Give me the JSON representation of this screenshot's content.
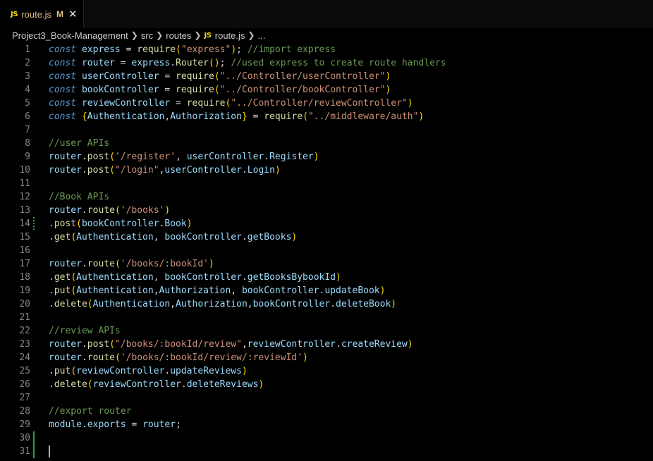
{
  "tab": {
    "icon": "JS",
    "name": "route.js",
    "modified_badge": "M",
    "close": "✕"
  },
  "breadcrumb": {
    "items": [
      "Project3_Book-Management",
      "src",
      "routes",
      "route.js",
      "..."
    ],
    "file_icon": "JS"
  },
  "colors": {
    "keyword": "#569cd6",
    "variable": "#9cdcfe",
    "function": "#dcdcaa",
    "string": "#ce9178",
    "comment": "#6a9955",
    "bracket_level1": "#ffd700",
    "bracket_level2": "#da70d6",
    "git_added": "#2ea043",
    "modified_tab": "#e2c08d"
  },
  "code_lines": [
    [
      {
        "t": "const",
        "c": "kw"
      },
      {
        "t": " "
      },
      {
        "t": "express",
        "c": "vr"
      },
      {
        "t": " = "
      },
      {
        "t": "require",
        "c": "fn"
      },
      {
        "t": "(",
        "c": "br1"
      },
      {
        "t": "\"express\"",
        "c": "st"
      },
      {
        "t": ")",
        "c": "br1"
      },
      {
        "t": "; "
      },
      {
        "t": "//import express",
        "c": "cm"
      }
    ],
    [
      {
        "t": "const",
        "c": "kw"
      },
      {
        "t": " "
      },
      {
        "t": "router",
        "c": "vr"
      },
      {
        "t": " = "
      },
      {
        "t": "express",
        "c": "vr"
      },
      {
        "t": "."
      },
      {
        "t": "Router",
        "c": "fn"
      },
      {
        "t": "()",
        "c": "br1"
      },
      {
        "t": "; "
      },
      {
        "t": "//used express to create route handlers",
        "c": "cm"
      }
    ],
    [
      {
        "t": "const",
        "c": "kw"
      },
      {
        "t": " "
      },
      {
        "t": "userController",
        "c": "vr"
      },
      {
        "t": " = "
      },
      {
        "t": "require",
        "c": "fn"
      },
      {
        "t": "(",
        "c": "br1"
      },
      {
        "t": "\"../Controller/userController\"",
        "c": "st"
      },
      {
        "t": ")",
        "c": "br1"
      }
    ],
    [
      {
        "t": "const",
        "c": "kw"
      },
      {
        "t": " "
      },
      {
        "t": "bookController",
        "c": "vr"
      },
      {
        "t": " = "
      },
      {
        "t": "require",
        "c": "fn"
      },
      {
        "t": "(",
        "c": "br1"
      },
      {
        "t": "\"../Controller/bookController\"",
        "c": "st"
      },
      {
        "t": ")",
        "c": "br1"
      }
    ],
    [
      {
        "t": "const",
        "c": "kw"
      },
      {
        "t": " "
      },
      {
        "t": "reviewController",
        "c": "vr"
      },
      {
        "t": " = "
      },
      {
        "t": "require",
        "c": "fn"
      },
      {
        "t": "(",
        "c": "br1"
      },
      {
        "t": "\"../Controller/reviewController\"",
        "c": "st"
      },
      {
        "t": ")",
        "c": "br1"
      }
    ],
    [
      {
        "t": "const",
        "c": "kw"
      },
      {
        "t": " "
      },
      {
        "t": "{",
        "c": "br1"
      },
      {
        "t": "Authentication",
        "c": "vr"
      },
      {
        "t": ","
      },
      {
        "t": "Authorization",
        "c": "vr"
      },
      {
        "t": "}",
        "c": "br1"
      },
      {
        "t": " = "
      },
      {
        "t": "require",
        "c": "fn"
      },
      {
        "t": "(",
        "c": "br1"
      },
      {
        "t": "\"../middleware/auth\"",
        "c": "st"
      },
      {
        "t": ")",
        "c": "br1"
      }
    ],
    [],
    [
      {
        "t": "//user APIs",
        "c": "cm"
      }
    ],
    [
      {
        "t": "router",
        "c": "vr"
      },
      {
        "t": "."
      },
      {
        "t": "post",
        "c": "fn"
      },
      {
        "t": "(",
        "c": "br1"
      },
      {
        "t": "'/register'",
        "c": "st"
      },
      {
        "t": ", "
      },
      {
        "t": "userController",
        "c": "vr"
      },
      {
        "t": "."
      },
      {
        "t": "Register",
        "c": "vr"
      },
      {
        "t": ")",
        "c": "br1"
      }
    ],
    [
      {
        "t": "router",
        "c": "vr"
      },
      {
        "t": "."
      },
      {
        "t": "post",
        "c": "fn"
      },
      {
        "t": "(",
        "c": "br1"
      },
      {
        "t": "\"/login\"",
        "c": "st"
      },
      {
        "t": ","
      },
      {
        "t": "userController",
        "c": "vr"
      },
      {
        "t": "."
      },
      {
        "t": "Login",
        "c": "vr"
      },
      {
        "t": ")",
        "c": "br1"
      }
    ],
    [],
    [
      {
        "t": "//Book APIs",
        "c": "cm"
      }
    ],
    [
      {
        "t": "router",
        "c": "vr"
      },
      {
        "t": "."
      },
      {
        "t": "route",
        "c": "fn"
      },
      {
        "t": "(",
        "c": "br1"
      },
      {
        "t": "'/books'",
        "c": "st"
      },
      {
        "t": ")",
        "c": "br1"
      }
    ],
    [
      {
        "t": "."
      },
      {
        "t": "post",
        "c": "fn"
      },
      {
        "t": "(",
        "c": "br1"
      },
      {
        "t": "bookController",
        "c": "vr"
      },
      {
        "t": "."
      },
      {
        "t": "Book",
        "c": "vr"
      },
      {
        "t": ")",
        "c": "br1"
      }
    ],
    [
      {
        "t": "."
      },
      {
        "t": "get",
        "c": "fn"
      },
      {
        "t": "(",
        "c": "br1"
      },
      {
        "t": "Authentication",
        "c": "vr"
      },
      {
        "t": ", "
      },
      {
        "t": "bookController",
        "c": "vr"
      },
      {
        "t": "."
      },
      {
        "t": "getBooks",
        "c": "vr"
      },
      {
        "t": ")",
        "c": "br1"
      }
    ],
    [],
    [
      {
        "t": "router",
        "c": "vr"
      },
      {
        "t": "."
      },
      {
        "t": "route",
        "c": "fn"
      },
      {
        "t": "(",
        "c": "br1"
      },
      {
        "t": "'/books/:bookId'",
        "c": "st"
      },
      {
        "t": ")",
        "c": "br1"
      }
    ],
    [
      {
        "t": "."
      },
      {
        "t": "get",
        "c": "fn"
      },
      {
        "t": "(",
        "c": "br1"
      },
      {
        "t": "Authentication",
        "c": "vr"
      },
      {
        "t": ", "
      },
      {
        "t": "bookController",
        "c": "vr"
      },
      {
        "t": "."
      },
      {
        "t": "getBooksBybookId",
        "c": "vr"
      },
      {
        "t": ")",
        "c": "br1"
      }
    ],
    [
      {
        "t": "."
      },
      {
        "t": "put",
        "c": "fn"
      },
      {
        "t": "(",
        "c": "br1"
      },
      {
        "t": "Authentication",
        "c": "vr"
      },
      {
        "t": ","
      },
      {
        "t": "Authorization",
        "c": "vr"
      },
      {
        "t": ", "
      },
      {
        "t": "bookController",
        "c": "vr"
      },
      {
        "t": "."
      },
      {
        "t": "updateBook",
        "c": "vr"
      },
      {
        "t": ")",
        "c": "br1"
      }
    ],
    [
      {
        "t": "."
      },
      {
        "t": "delete",
        "c": "fn"
      },
      {
        "t": "(",
        "c": "br1"
      },
      {
        "t": "Authentication",
        "c": "vr"
      },
      {
        "t": ","
      },
      {
        "t": "Authorization",
        "c": "vr"
      },
      {
        "t": ","
      },
      {
        "t": "bookController",
        "c": "vr"
      },
      {
        "t": "."
      },
      {
        "t": "deleteBook",
        "c": "vr"
      },
      {
        "t": ")",
        "c": "br1"
      }
    ],
    [],
    [
      {
        "t": "//review APIs",
        "c": "cm"
      }
    ],
    [
      {
        "t": "router",
        "c": "vr"
      },
      {
        "t": "."
      },
      {
        "t": "post",
        "c": "fn"
      },
      {
        "t": "(",
        "c": "br1"
      },
      {
        "t": "\"/books/:bookId/review\"",
        "c": "st"
      },
      {
        "t": ","
      },
      {
        "t": "reviewController",
        "c": "vr"
      },
      {
        "t": "."
      },
      {
        "t": "createReview",
        "c": "vr"
      },
      {
        "t": ")",
        "c": "br1"
      }
    ],
    [
      {
        "t": "router",
        "c": "vr"
      },
      {
        "t": "."
      },
      {
        "t": "route",
        "c": "fn"
      },
      {
        "t": "(",
        "c": "br1"
      },
      {
        "t": "'/books/:bookId/review/:reviewId'",
        "c": "st"
      },
      {
        "t": ")",
        "c": "br1"
      }
    ],
    [
      {
        "t": "."
      },
      {
        "t": "put",
        "c": "fn"
      },
      {
        "t": "(",
        "c": "br1"
      },
      {
        "t": "reviewController",
        "c": "vr"
      },
      {
        "t": "."
      },
      {
        "t": "updateReviews",
        "c": "vr"
      },
      {
        "t": ")",
        "c": "br1"
      }
    ],
    [
      {
        "t": "."
      },
      {
        "t": "delete",
        "c": "fn"
      },
      {
        "t": "(",
        "c": "br1"
      },
      {
        "t": "reviewController",
        "c": "vr"
      },
      {
        "t": "."
      },
      {
        "t": "deleteReviews",
        "c": "vr"
      },
      {
        "t": ")",
        "c": "br1"
      }
    ],
    [],
    [
      {
        "t": "//export router",
        "c": "cm"
      }
    ],
    [
      {
        "t": "module",
        "c": "vr"
      },
      {
        "t": "."
      },
      {
        "t": "exports",
        "c": "vr"
      },
      {
        "t": " = "
      },
      {
        "t": "router",
        "c": "vr"
      },
      {
        "t": ";"
      }
    ],
    [],
    []
  ]
}
